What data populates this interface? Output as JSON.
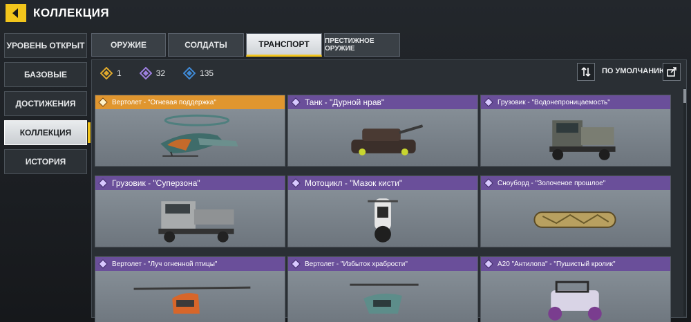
{
  "header": {
    "title": "КОЛЛЕКЦИЯ"
  },
  "sidebar": {
    "items": [
      {
        "label": "УРОВЕНЬ ОТКРЫТ"
      },
      {
        "label": "БАЗОВЫЕ"
      },
      {
        "label": "ДОСТИЖЕНИЯ"
      },
      {
        "label": "КОЛЛЕКЦИЯ",
        "active": true
      },
      {
        "label": "ИСТОРИЯ"
      }
    ]
  },
  "tabs": [
    {
      "label": "ОРУЖИЕ"
    },
    {
      "label": "СОЛДАТЫ"
    },
    {
      "label": "ТРАНСПОРТ",
      "active": true
    },
    {
      "label": "ПРЕСТИЖНОЕ ОРУЖИЕ"
    }
  ],
  "counters": [
    {
      "icon": "legendary-diamond-icon",
      "value": "1",
      "color": "#e0a92c"
    },
    {
      "icon": "epic-diamond-icon",
      "value": "32",
      "color": "#8c6bcc"
    },
    {
      "icon": "rare-diamond-icon",
      "value": "135",
      "color": "#3f8ad6"
    }
  ],
  "sort": {
    "label": "ПО УМОЛЧАНИЮ"
  },
  "colors": {
    "accent": "#f2c51c",
    "legendary": "#e0962f",
    "epic": "#6a4f9a"
  },
  "cards": [
    {
      "name": "Вертолет - \"Огневая поддержка\"",
      "rarity": "legendary",
      "vehicle": "helicopter"
    },
    {
      "name": "Танк - \"Дурной нрав\"",
      "rarity": "epic",
      "vehicle": "tank"
    },
    {
      "name": "Грузовик - \"Водонепроницаемость\"",
      "rarity": "epic",
      "vehicle": "truck"
    },
    {
      "name": "Грузовик - \"Суперзона\"",
      "rarity": "epic",
      "vehicle": "truck"
    },
    {
      "name": "Мотоцикл - \"Мазок кисти\"",
      "rarity": "epic",
      "vehicle": "motorcycle"
    },
    {
      "name": "Сноуборд - \"Золоченое прошлое\"",
      "rarity": "epic",
      "vehicle": "snowboard"
    },
    {
      "name": "Вертолет - \"Луч огненной птицы\"",
      "rarity": "epic",
      "vehicle": "helicopter"
    },
    {
      "name": "Вертолет - \"Избыток храбрости\"",
      "rarity": "epic",
      "vehicle": "helicopter"
    },
    {
      "name": "A20 \"Антилопа\" - \"Пушистый кролик\"",
      "rarity": "epic",
      "vehicle": "buggy"
    }
  ]
}
